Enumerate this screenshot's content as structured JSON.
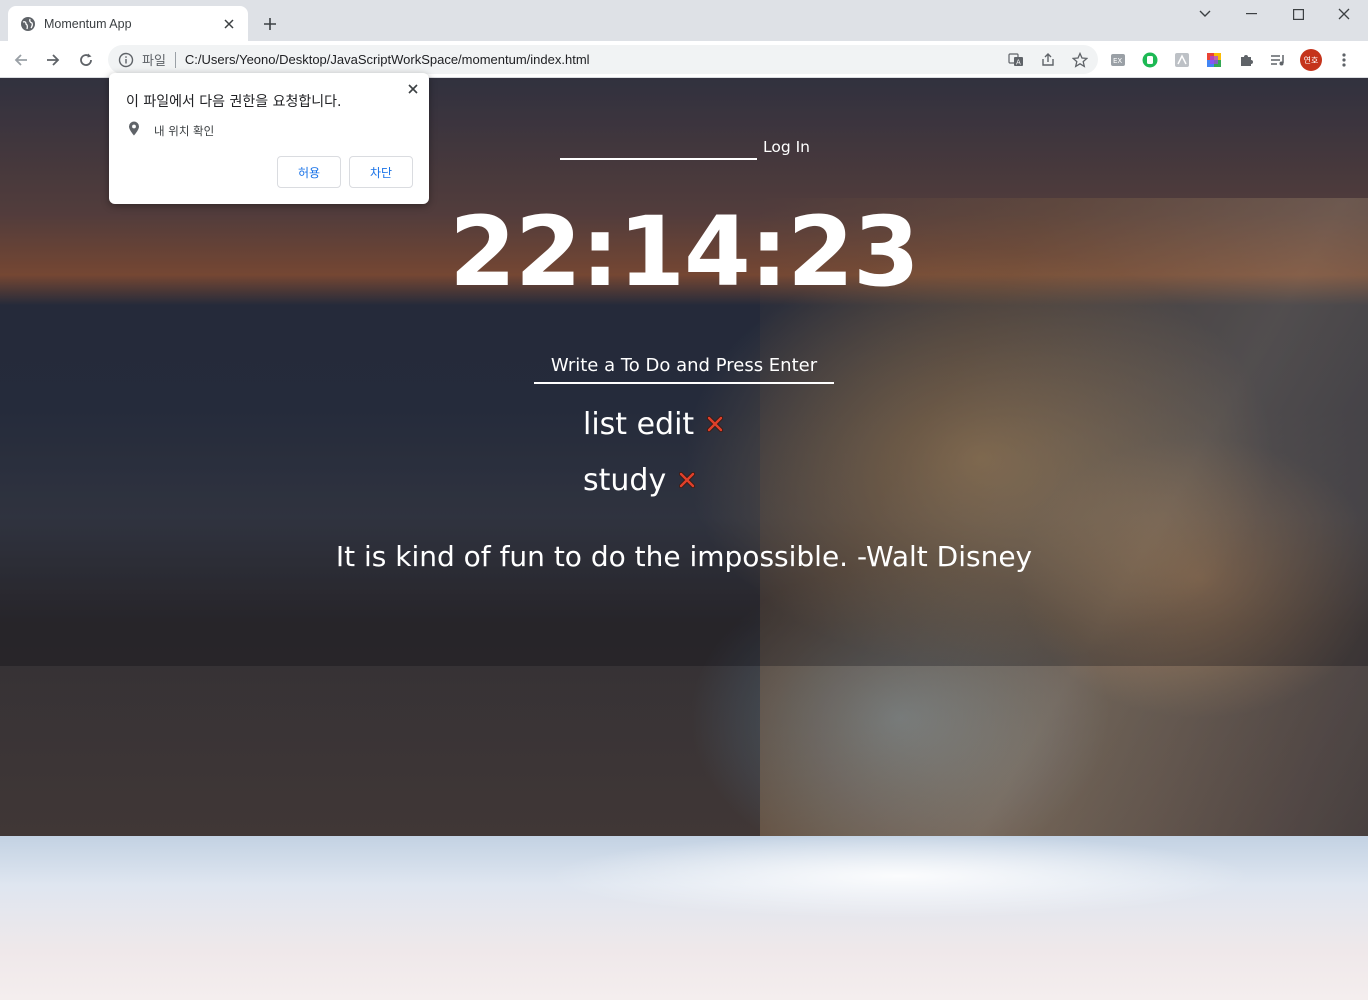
{
  "browser": {
    "tab_title": "Momentum App",
    "address_scheme": "파일",
    "address_url": "C:/Users/Yeono/Desktop/JavaScriptWorkSpace/momentum/index.html",
    "profile_label": "연호"
  },
  "permission_popup": {
    "title": "이 파일에서 다음 권한을 요청합니다.",
    "permission": "내 위치 확인",
    "allow_label": "허용",
    "block_label": "차단"
  },
  "login": {
    "input_value": "",
    "button_label": "Log In"
  },
  "clock": "22:14:23",
  "todo": {
    "placeholder": "Write a To Do and Press Enter",
    "items": [
      {
        "text": "list edit"
      },
      {
        "text": "study"
      }
    ]
  },
  "quote": "It is kind of fun to do the impossible. -Walt Disney",
  "colors": {
    "accent": "#1a73e8",
    "delete_icon": "#e0402a",
    "profile": "#c5341c"
  }
}
